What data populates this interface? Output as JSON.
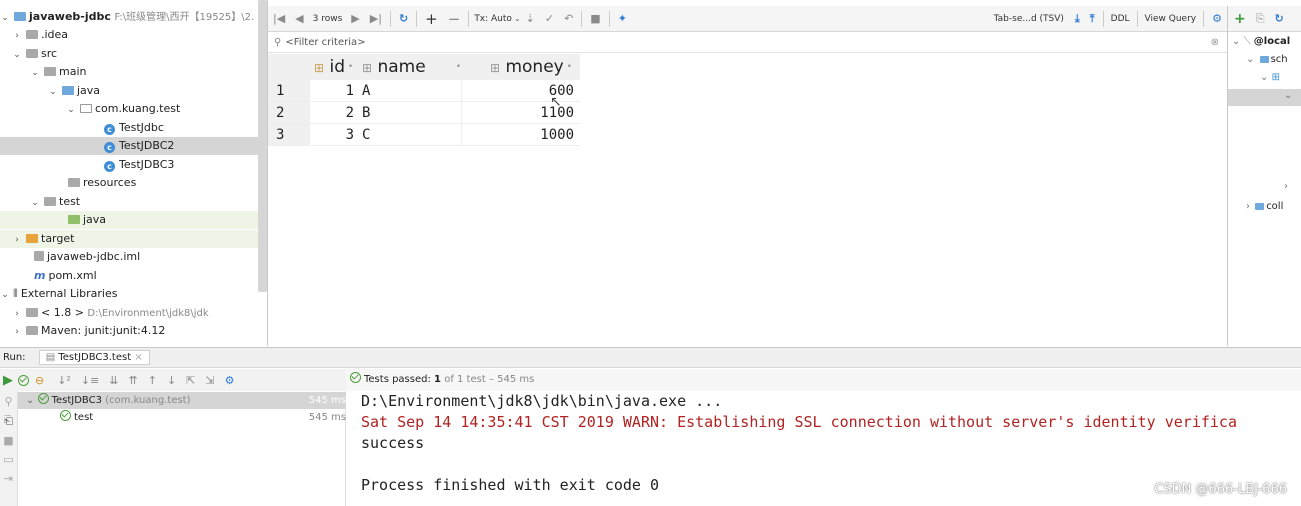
{
  "tree": {
    "root_label": "javaweb-jdbc",
    "root_path": "F:\\班级管理\\西开【19525】\\2.",
    "items": [
      {
        "label": "idea",
        "prefix": "."
      },
      {
        "label": "src"
      },
      {
        "label": "main"
      },
      {
        "label": "java"
      },
      {
        "label": "com.kuang.test"
      },
      {
        "label": "TestJdbc"
      },
      {
        "label": "TestJDBC2"
      },
      {
        "label": "TestJDBC3"
      },
      {
        "label": "resources"
      },
      {
        "label": "test"
      },
      {
        "label": "java"
      },
      {
        "label": "target"
      },
      {
        "label": "javaweb-jdbc.iml"
      },
      {
        "label": "pom.xml"
      },
      {
        "label": "External Libraries"
      },
      {
        "label": "< 1.8 >",
        "path": "D:\\Environment\\jdk8\\jdk"
      },
      {
        "label": "Maven: junit:junit:4.12"
      }
    ]
  },
  "toolbar": {
    "rows": "3 rows",
    "tx": "Tx: Auto",
    "format": "Tab-se...d (TSV)",
    "ddl": "DDL",
    "view_query": "View Query"
  },
  "filter": {
    "placeholder": "<Filter criteria>"
  },
  "grid": {
    "columns": [
      "id",
      "name",
      "money"
    ],
    "rows": [
      {
        "num": "1",
        "id": "1",
        "name": "A",
        "money": "600"
      },
      {
        "num": "2",
        "id": "2",
        "name": "B",
        "money": "1100"
      },
      {
        "num": "3",
        "id": "3",
        "name": "C",
        "money": "1000"
      }
    ]
  },
  "right_panel": {
    "local": "@local",
    "sch": "sch",
    "coll": "coll"
  },
  "run": {
    "label": "Run:",
    "tab": "TestJDBC3.test",
    "status_prefix": "Tests passed:",
    "status_count": "1",
    "status_rest": "of 1 test – 545 ms",
    "test_class": "TestJDBC3",
    "test_pkg": "(com.kuang.test)",
    "test_class_time": "545 ms",
    "test_method": "test",
    "test_method_time": "545 ms"
  },
  "console": {
    "line1": "D:\\Environment\\jdk8\\jdk\\bin\\java.exe ...",
    "line2": "Sat Sep 14 14:35:41 CST 2019 WARN: Establishing SSL connection without server's identity verifica",
    "line3": "success",
    "line4": "Process finished with exit code 0"
  },
  "watermark": "CSDN @666-LBJ-666",
  "colors": {
    "warn": "#b22222",
    "pass": "#4a9e3a",
    "accent": "#3d8ed6"
  }
}
